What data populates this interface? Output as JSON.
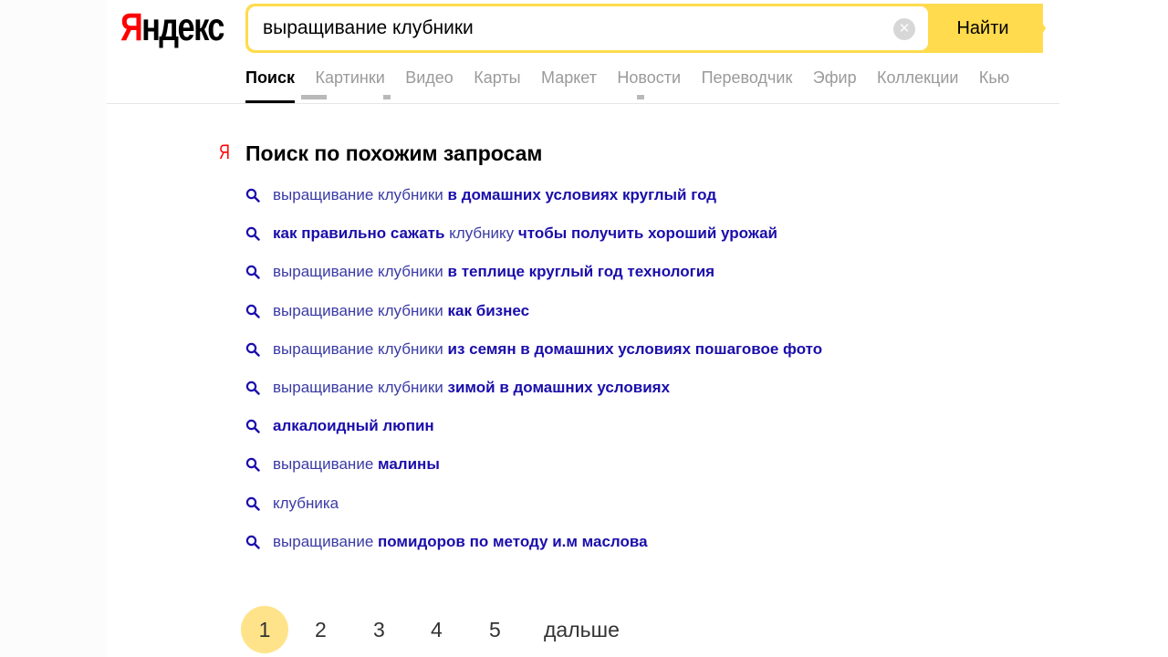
{
  "logo": {
    "first": "Я",
    "rest": "ндекс"
  },
  "search": {
    "query": "выращивание клубники",
    "button_label": "Найти",
    "clear_glyph": "×"
  },
  "nav": {
    "tabs": [
      {
        "label": "Поиск",
        "active": true
      },
      {
        "label": "Картинки"
      },
      {
        "label": "Видео"
      },
      {
        "label": "Карты"
      },
      {
        "label": "Маркет"
      },
      {
        "label": "Новости"
      },
      {
        "label": "Переводчик"
      },
      {
        "label": "Эфир"
      },
      {
        "label": "Коллекции"
      },
      {
        "label": "Кью"
      }
    ]
  },
  "related": {
    "mark": "Я",
    "title": "Поиск по похожим запросам",
    "items": [
      {
        "parts": [
          {
            "text": "выращивание клубники ",
            "bold": false
          },
          {
            "text": "в домашних условиях круглый год",
            "bold": true
          }
        ]
      },
      {
        "parts": [
          {
            "text": "как правильно сажать ",
            "bold": true
          },
          {
            "text": "клубнику ",
            "bold": false
          },
          {
            "text": "чтобы получить хороший урожай",
            "bold": true
          }
        ]
      },
      {
        "parts": [
          {
            "text": "выращивание клубники ",
            "bold": false
          },
          {
            "text": "в теплице круглый год технология",
            "bold": true
          }
        ]
      },
      {
        "parts": [
          {
            "text": "выращивание клубники ",
            "bold": false
          },
          {
            "text": "как бизнес",
            "bold": true
          }
        ]
      },
      {
        "parts": [
          {
            "text": "выращивание клубники ",
            "bold": false
          },
          {
            "text": "из семян в домашних условиях пошаговое фото",
            "bold": true
          }
        ]
      },
      {
        "parts": [
          {
            "text": "выращивание клубники ",
            "bold": false
          },
          {
            "text": "зимой в домашних условиях",
            "bold": true
          }
        ]
      },
      {
        "parts": [
          {
            "text": "алкалоидный люпин",
            "bold": true
          }
        ]
      },
      {
        "parts": [
          {
            "text": "выращивание ",
            "bold": false
          },
          {
            "text": "малины",
            "bold": true
          }
        ]
      },
      {
        "parts": [
          {
            "text": "клубника",
            "bold": false
          }
        ]
      },
      {
        "parts": [
          {
            "text": "выращивание ",
            "bold": false
          },
          {
            "text": "помидоров по методу и.м маслова",
            "bold": true
          }
        ]
      }
    ]
  },
  "pager": {
    "current": "1",
    "pages": [
      "2",
      "3",
      "4",
      "5"
    ],
    "next_label": "дальше"
  },
  "colors": {
    "accent_yellow": "#ffdb4d",
    "link_blue": "#1a0dab",
    "brand_red": "#ff0000",
    "current_page": "#ffe38a"
  },
  "icons": {
    "related_item": "search-icon",
    "clear": "clear-icon"
  }
}
